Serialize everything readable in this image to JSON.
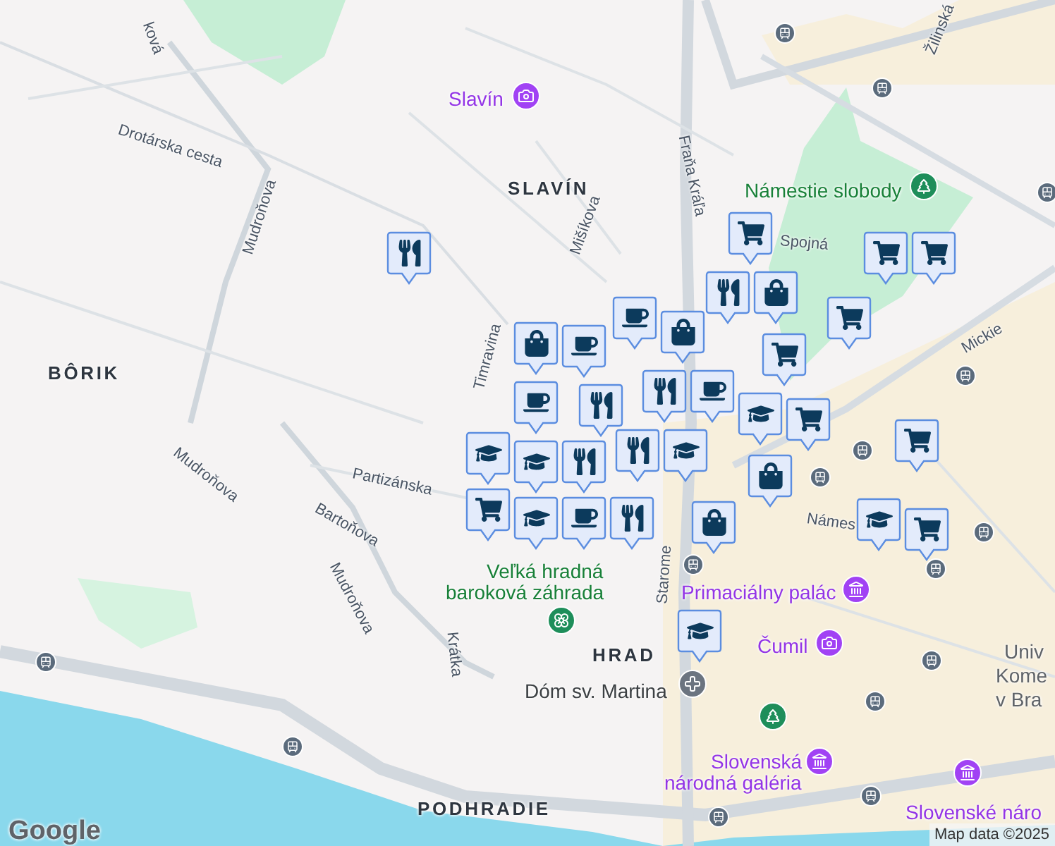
{
  "map": {
    "labels": [
      {
        "text": "ková",
        "kind": "street"
      },
      {
        "text": "Drotárska cesta",
        "kind": "street"
      },
      {
        "text": "Mudroňova",
        "kind": "street"
      },
      {
        "text": "Slavín",
        "kind": "museum"
      },
      {
        "text": "SLAVÍN",
        "kind": "district"
      },
      {
        "text": "Mišíkova",
        "kind": "street"
      },
      {
        "text": "Fraňa Kráľa",
        "kind": "street"
      },
      {
        "text": "Žilinská",
        "kind": "street"
      },
      {
        "text": "Námestie slobody",
        "kind": "park"
      },
      {
        "text": "Spojná",
        "kind": "street"
      },
      {
        "text": "Timravina",
        "kind": "street"
      },
      {
        "text": "BÔRIK",
        "kind": "district"
      },
      {
        "text": "Mudroňova",
        "kind": "street"
      },
      {
        "text": "Partizánska",
        "kind": "street"
      },
      {
        "text": "Bartoňova",
        "kind": "street"
      },
      {
        "text": "Mudroňova",
        "kind": "street"
      },
      {
        "text": "Mickie",
        "kind": "street"
      },
      {
        "text": "Námes",
        "kind": "street"
      },
      {
        "text": "Veľká hradná",
        "kind": "park"
      },
      {
        "text": "baroková záhrada",
        "kind": "park"
      },
      {
        "text": "Krátka",
        "kind": "street"
      },
      {
        "text": "Starome",
        "kind": "street"
      },
      {
        "text": "Primaciálny palác",
        "kind": "museum"
      },
      {
        "text": "Čumil",
        "kind": "museum"
      },
      {
        "text": "HRAD",
        "kind": "district"
      },
      {
        "text": "Dóm sv. Martina",
        "kind": "church"
      },
      {
        "text": "Univ",
        "kind": "place"
      },
      {
        "text": "Kome",
        "kind": "place"
      },
      {
        "text": "v Bra",
        "kind": "place"
      },
      {
        "text": "Slovenská",
        "kind": "museum"
      },
      {
        "text": "národná galéria",
        "kind": "museum"
      },
      {
        "text": "PODHRADIE",
        "kind": "district"
      },
      {
        "text": "Slovenské náro",
        "kind": "museum"
      }
    ],
    "markers": [
      {
        "kind": "restaurant"
      },
      {
        "kind": "grocery"
      },
      {
        "kind": "restaurant"
      },
      {
        "kind": "shop"
      },
      {
        "kind": "grocery"
      },
      {
        "kind": "grocery"
      },
      {
        "kind": "grocery"
      },
      {
        "kind": "cafe"
      },
      {
        "kind": "shop"
      },
      {
        "kind": "grocery"
      },
      {
        "kind": "shop"
      },
      {
        "kind": "cafe"
      },
      {
        "kind": "restaurant"
      },
      {
        "kind": "cafe"
      },
      {
        "kind": "restaurant"
      },
      {
        "kind": "school"
      },
      {
        "kind": "grocery"
      },
      {
        "kind": "school"
      },
      {
        "kind": "restaurant"
      },
      {
        "kind": "restaurant"
      },
      {
        "kind": "school"
      },
      {
        "kind": "school"
      },
      {
        "kind": "grocery"
      },
      {
        "kind": "shop"
      },
      {
        "kind": "grocery"
      },
      {
        "kind": "school"
      },
      {
        "kind": "cafe"
      },
      {
        "kind": "restaurant"
      },
      {
        "kind": "shop"
      },
      {
        "kind": "school"
      },
      {
        "kind": "grocery"
      },
      {
        "kind": "school"
      },
      {
        "kind": "cafe"
      }
    ]
  },
  "logo": "Google",
  "attribution": "Map data ©2025"
}
